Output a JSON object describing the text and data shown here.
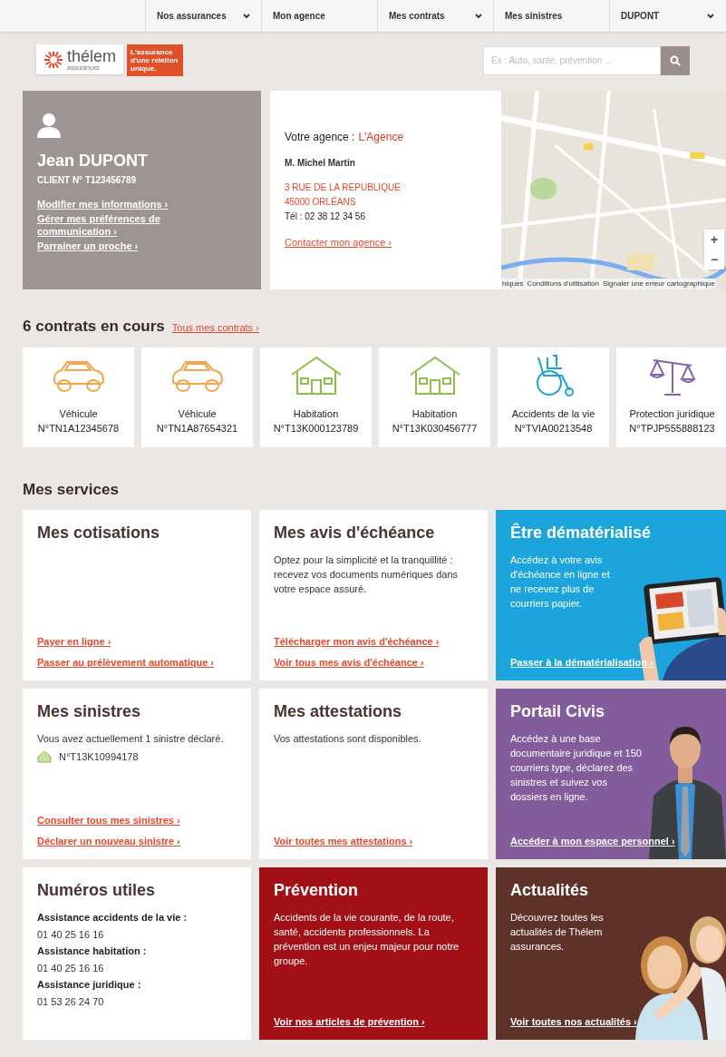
{
  "nav": [
    {
      "label": "Nos assurances",
      "dropdown": true
    },
    {
      "label": "Mon agence",
      "dropdown": false
    },
    {
      "label": "Mes contrats",
      "dropdown": true
    },
    {
      "label": "Mes sinistres",
      "dropdown": false
    },
    {
      "label": "DUPONT",
      "dropdown": true
    }
  ],
  "logo": {
    "brand": "thélem",
    "sub": "assurances",
    "tagline": "L'assurance d'une relation unique."
  },
  "search": {
    "placeholder": "Ex : Auto, santé, prévention ..."
  },
  "profile": {
    "name": "Jean DUPONT",
    "client": "CLIENT N° T123456789",
    "links": [
      "Modifier mes informations ›",
      "Gérer mes préférences de communication ›",
      "Parrainer un proche ›"
    ]
  },
  "agency": {
    "label": "Votre agence :",
    "name": "L'Agence",
    "agent": "M. Michel Martin",
    "address": [
      "3 RUE DE LA RÉPUBLIQUE",
      "45000 ORLÉANS"
    ],
    "phone": "Tél : 02 38 12 34 56",
    "contact": "Contacter mon agence ›"
  },
  "map": {
    "zoom_in": "+",
    "zoom_out": "−",
    "attribution": [
      "hiques",
      "Conditions d'utilisation",
      "Signaler une erreur cartographique"
    ]
  },
  "contracts": {
    "title": "6 contrats en cours",
    "link": "Tous mes contrats ›",
    "items": [
      {
        "kind": "car",
        "label": "Véhicule",
        "number": "N°TN1A12345678"
      },
      {
        "kind": "car",
        "label": "Véhicule",
        "number": "N°TN1A87654321"
      },
      {
        "kind": "house",
        "label": "Habitation",
        "number": "N°T13K000123789"
      },
      {
        "kind": "house",
        "label": "Habitation",
        "number": "N°T13K030456777"
      },
      {
        "kind": "wheelchair",
        "label": "Accidents de la vie",
        "number": "N°TVIA00213548"
      },
      {
        "kind": "scales",
        "label": "Protection juridique",
        "number": "N°TPJP555888123"
      }
    ]
  },
  "services": {
    "title": "Mes services",
    "cards": [
      {
        "kind": "white",
        "title": "Mes cotisations",
        "links": [
          "Payer en ligne ›",
          "Passer au prélèvement automatique ›"
        ]
      },
      {
        "kind": "white",
        "title": "Mes avis d'échéance",
        "text": "Optez pour la simplicité et la tranquillité : recevez vos documents numériques dans votre espace assuré.",
        "links": [
          "Télécharger mon avis d'échéance ›",
          "Voir tous mes avis d'échéance ›"
        ]
      },
      {
        "kind": "blue",
        "title": "Être dématérialisé",
        "text": "Accédez à votre avis d'échéance en ligne et ne recevez plus de courriers papier.",
        "links": [
          "Passer à la dématérialisation ›"
        ]
      },
      {
        "kind": "white",
        "title": "Mes sinistres",
        "text": "Vous avez actuellement 1 sinistre déclaré.",
        "claim": "N°T13K10994178",
        "links": [
          "Consulter tous mes sinistres ›",
          "Déclarer un nouveau sinistre ›"
        ]
      },
      {
        "kind": "white",
        "title": "Mes attestations",
        "text": "Vos attestations sont disponibles.",
        "links": [
          "Voir toutes mes attestations ›"
        ]
      },
      {
        "kind": "purple",
        "title": "Portail Civis",
        "text": "Accédez à une base documentaire juridique et 150 courriers type, déclarez des sinistres et suivez vos dossiers en ligne.",
        "links": [
          "Accéder à mon espace personnel ›"
        ]
      },
      {
        "kind": "white",
        "title": "Numéros utiles",
        "numbers": [
          {
            "label": "Assistance accidents de la vie :",
            "phone": "01 40 25 16 16"
          },
          {
            "label": "Assistance habitation :",
            "phone": "01 40 25 16 16"
          },
          {
            "label": "Assistance juridique :",
            "phone": "01 53 26 24 70"
          }
        ]
      },
      {
        "kind": "red",
        "title": "Prévention",
        "text": "Accidents de la vie courante, de la route, santé, accidents professionnels. La prévention est un enjeu majeur pour notre groupe.",
        "links": [
          "Voir nos articles de prévention ›"
        ]
      },
      {
        "kind": "brown",
        "title": "Actualités",
        "text": "Découvrez toutes les actualités de Thélem assurances.",
        "links": [
          "Voir toutes nos actualités ›"
        ]
      }
    ]
  }
}
